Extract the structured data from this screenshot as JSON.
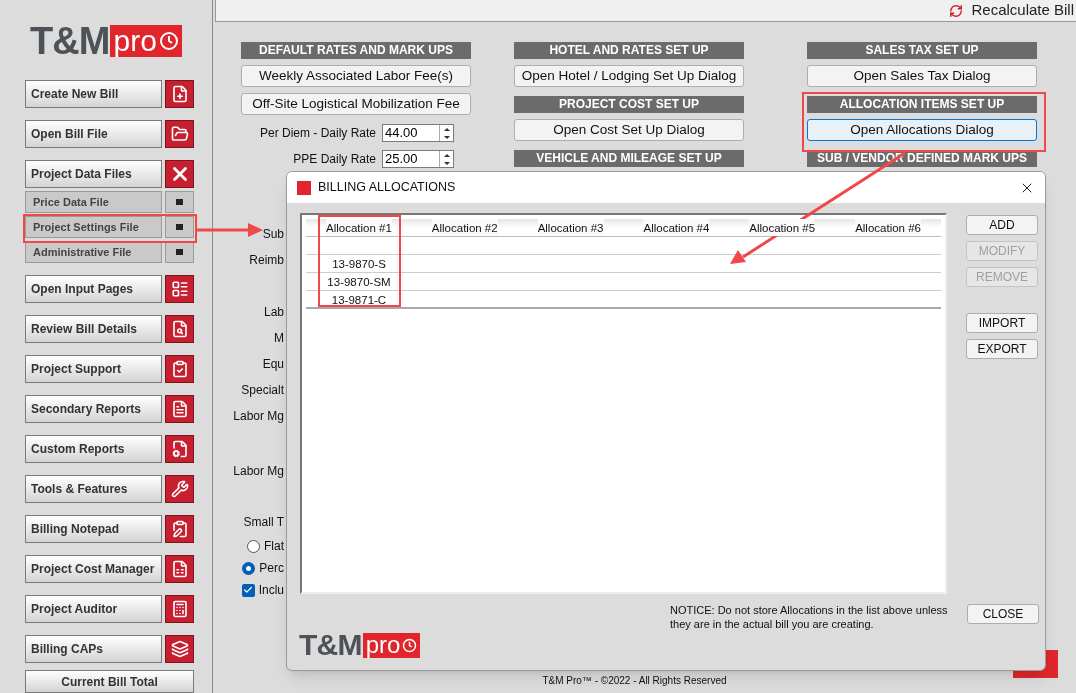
{
  "sidebar": {
    "logo": {
      "main": "T&M",
      "suffix": "pro"
    },
    "items": [
      {
        "label": "Create New Bill",
        "kind": "button"
      },
      {
        "label": "Open Bill File",
        "kind": "button"
      },
      {
        "label": "Project Data Files",
        "kind": "group",
        "expanded": true,
        "children": [
          {
            "label": "Price Data File"
          },
          {
            "label": "Project Settings File"
          },
          {
            "label": "Administrative File"
          }
        ]
      },
      {
        "label": "Open Input Pages",
        "kind": "button"
      },
      {
        "label": "Review Bill Details",
        "kind": "button"
      },
      {
        "label": "Project Support",
        "kind": "button"
      },
      {
        "label": "Secondary Reports",
        "kind": "button"
      },
      {
        "label": "Custom Reports",
        "kind": "button"
      },
      {
        "label": "Tools & Features",
        "kind": "button"
      },
      {
        "label": "Billing Notepad",
        "kind": "button"
      },
      {
        "label": "Project Cost Manager",
        "kind": "button"
      },
      {
        "label": "Project Auditor",
        "kind": "button"
      },
      {
        "label": "Billing CAPs",
        "kind": "button"
      }
    ],
    "total_button": "Current Bill Total"
  },
  "toolbar": {
    "recalculate": "Recalculate Bill"
  },
  "columns": [
    {
      "sections": [
        {
          "title": "DEFAULT RATES AND MARK UPS",
          "buttons": [
            {
              "label": "Weekly Associated  Labor Fee(s)",
              "focused": false
            },
            {
              "label": "Off-Site Logistical Mobilization Fee",
              "focused": false
            }
          ]
        }
      ],
      "fields": [
        {
          "label": "Per Diem - Daily Rate",
          "value": "44.00"
        },
        {
          "label": "PPE Daily Rate",
          "value": "25.00"
        }
      ],
      "partial_labels": [
        {
          "kind": "label",
          "text": "Sub"
        },
        {
          "kind": "label",
          "text": "Reimb"
        },
        {
          "kind": "label",
          "text": "Lab"
        },
        {
          "kind": "label",
          "text": "M"
        },
        {
          "kind": "label",
          "text": "Equ"
        },
        {
          "kind": "label",
          "text": "Specialt"
        },
        {
          "kind": "label",
          "text": "Labor Mg"
        },
        {
          "kind": "label",
          "text": "Labor Mg"
        },
        {
          "kind": "label",
          "text": "Small T"
        },
        {
          "kind": "radio",
          "text": "Flat",
          "selected": false
        },
        {
          "kind": "radio",
          "text": "Perc",
          "selected": true
        },
        {
          "kind": "checkbox",
          "text": "Inclu",
          "checked": true
        }
      ]
    },
    {
      "sections": [
        {
          "title": "HOTEL AND RATES SET UP",
          "buttons": [
            {
              "label": "Open Hotel / Lodging Set Up Dialog",
              "focused": false
            }
          ]
        },
        {
          "title": "PROJECT COST SET UP",
          "buttons": [
            {
              "label": "Open Cost Set Up Dialog",
              "focused": false
            }
          ]
        },
        {
          "title": "VEHICLE AND MILEAGE SET UP"
        }
      ]
    },
    {
      "sections": [
        {
          "title": "SALES TAX SET UP",
          "buttons": [
            {
              "label": "Open Sales Tax Dialog",
              "focused": false
            }
          ]
        },
        {
          "title": "ALLOCATION ITEMS SET UP",
          "buttons": [
            {
              "label": "Open Allocations Dialog",
              "focused": true
            }
          ]
        },
        {
          "title": "SUB / VENDOR DEFINED MARK UPS"
        }
      ]
    }
  ],
  "footer": "T&M Pro™ - ©2022 - All Rights Reserved",
  "dialog": {
    "title": "BILLING ALLOCATIONS",
    "table": {
      "columns": [
        "Allocation #1",
        "Allocation #2",
        "Allocation #3",
        "Allocation #4",
        "Allocation #5",
        "Allocation #6"
      ],
      "rows": [
        {
          "cells": [
            "13-9870-S"
          ]
        },
        {
          "cells": [
            "13-9870-SM"
          ]
        },
        {
          "cells": [
            "13-9871-C"
          ]
        }
      ]
    },
    "buttons": [
      {
        "label": "ADD",
        "disabled": false
      },
      {
        "label": "MODIFY",
        "disabled": true
      },
      {
        "label": "REMOVE",
        "disabled": true
      },
      {
        "label": "IMPORT",
        "disabled": false
      },
      {
        "label": "EXPORT",
        "disabled": false
      }
    ],
    "notice": "NOTICE:  Do not store Allocations in the list above unless they are in the actual bill you are creating.",
    "close": "CLOSE",
    "logo": {
      "main": "T&M",
      "suffix": "pro"
    }
  }
}
